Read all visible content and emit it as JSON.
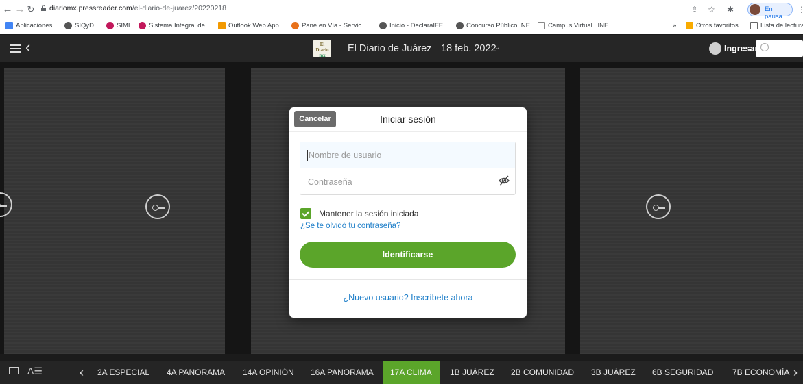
{
  "browser": {
    "url_host": "diariomx.pressreader.com",
    "url_path": "/el-diario-de-juarez/20220218",
    "profile_label": "En pausa"
  },
  "bookmarks": [
    {
      "label": "Aplicaciones",
      "color": "#4285f4"
    },
    {
      "label": "SIQyD",
      "color": "#555555"
    },
    {
      "label": "SIMI",
      "color": "#c2185b"
    },
    {
      "label": "Sistema Integral de...",
      "color": "#c2185b"
    },
    {
      "label": "Outlook Web App",
      "color": "#f29900"
    },
    {
      "label": "Pane en Vía - Servic...",
      "color": "#e8711a"
    },
    {
      "label": "Inicio - DeclaraIFE",
      "color": "#555555"
    },
    {
      "label": "Concurso Público INE",
      "color": "#555555"
    },
    {
      "label": "Campus Virtual | INE",
      "color": "#888888"
    }
  ],
  "bookmarks_right": {
    "overflow": "»",
    "other": "Otros favoritos",
    "reading_list": "Lista de lectura"
  },
  "header": {
    "logo_line1": "El Diario",
    "logo_line2": "mx",
    "publication": "El Diario de Juárez",
    "date": "18 feb. 2022",
    "login_label": "Ingresar",
    "search_placeholder": ""
  },
  "modal": {
    "cancel_label": "Cancelar",
    "title": "Iniciar sesión",
    "username_placeholder": "Nombre de usuario",
    "password_placeholder": "Contraseña",
    "remember_label": "Mantener la sesión iniciada",
    "remember_checked": true,
    "forgot_link": "¿Se te olvidó tu contraseña?",
    "submit_label": "Identificarse",
    "signup_link": "¿Nuevo usuario? Inscríbete ahora"
  },
  "sections": [
    {
      "label": "2A ESPECIAL",
      "active": false
    },
    {
      "label": "4A PANORAMA",
      "active": false
    },
    {
      "label": "14A OPINIÓN",
      "active": false
    },
    {
      "label": "16A PANORAMA",
      "active": false
    },
    {
      "label": "17A CLIMA",
      "active": true
    },
    {
      "label": "1B JUÁREZ",
      "active": false
    },
    {
      "label": "2B COMUNIDAD",
      "active": false
    },
    {
      "label": "3B JUÁREZ",
      "active": false
    },
    {
      "label": "6B SEGURIDAD",
      "active": false
    },
    {
      "label": "7B ECONOMÍA",
      "active": false
    }
  ],
  "colors": {
    "accent_green": "#5ba52a",
    "link_blue": "#1f7fc9",
    "header_bg": "#262626"
  }
}
